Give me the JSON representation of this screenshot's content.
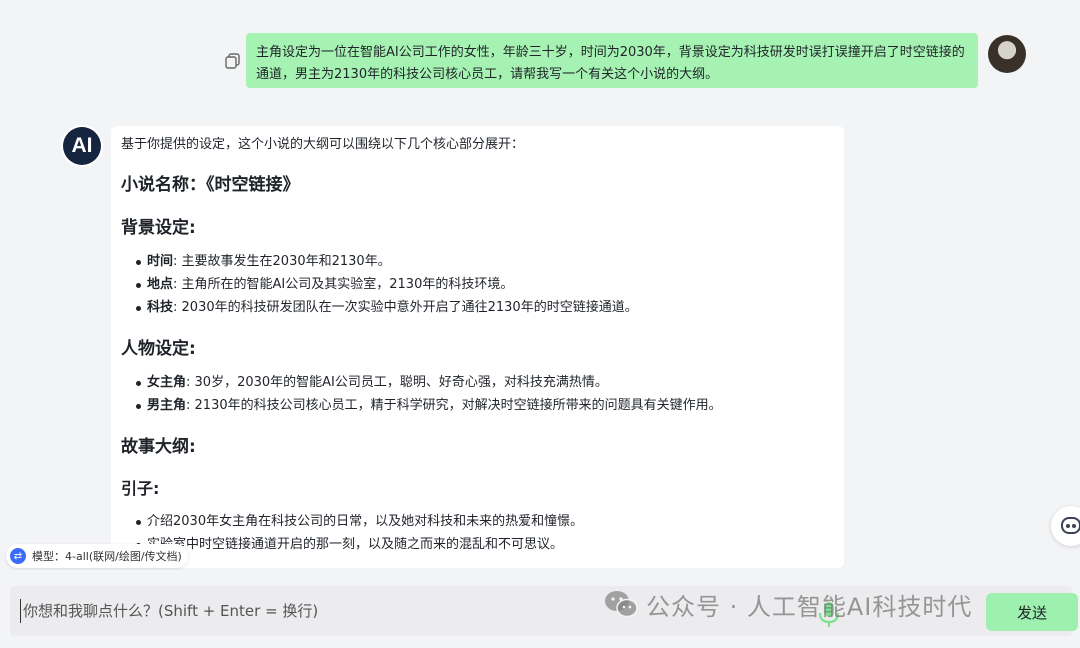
{
  "user_message": {
    "text": "主角设定为一位在智能AI公司工作的女性，年龄三十岁，时间为2030年，背景设定为科技研发时误打误撞开启了时空链接的通道，男主为2130年的科技公司核心员工，请帮我写一个有关这个小说的大纲。",
    "bubble_color": "#a6f2b2"
  },
  "ai_avatar": {
    "label": "AI"
  },
  "ai_message": {
    "intro": "基于你提供的设定，这个小说的大纲可以围绕以下几个核心部分展开：",
    "title": "小说名称：《时空链接》",
    "background": {
      "heading": "背景设定:",
      "items": [
        {
          "term": "时间",
          "text": ": 主要故事发生在2030年和2130年。"
        },
        {
          "term": "地点",
          "text": ": 主角所在的智能AI公司及其实验室，2130年的科技环境。"
        },
        {
          "term": "科技",
          "text": ": 2030年的科技研发团队在一次实验中意外开启了通往2130年的时空链接通道。"
        }
      ]
    },
    "characters": {
      "heading": "人物设定:",
      "items": [
        {
          "term": "女主角",
          "text": ": 30岁，2030年的智能AI公司员工，聪明、好奇心强，对科技充满热情。"
        },
        {
          "term": "男主角",
          "text": ": 2130年的科技公司核心员工，精于科学研究，对解决时空链接所带来的问题具有关键作用。"
        }
      ]
    },
    "story": {
      "heading": "故事大纲:",
      "sub_heading": "引子:",
      "items": [
        {
          "text": "介绍2030年女主角在科技公司的日常，以及她对科技和未来的热爱和憧憬。"
        },
        {
          "text": "实验室中时空链接通道开启的那一刻，以及随之而来的混乱和不可思议。"
        }
      ]
    }
  },
  "model_pill": {
    "icon": "⇄",
    "label": "模型：4-all(联网/绘图/传文档)"
  },
  "input": {
    "placeholder": "你想和我聊点什么？(Shift + Enter = 换行)"
  },
  "send_button": {
    "label": "发送"
  },
  "watermark": {
    "text": "公众号 · 人工智能AI科技时代"
  },
  "colors": {
    "send": "#9ef0ae",
    "ai_avatar_bg": "#15243f",
    "page_bg": "#f3f4f6"
  }
}
